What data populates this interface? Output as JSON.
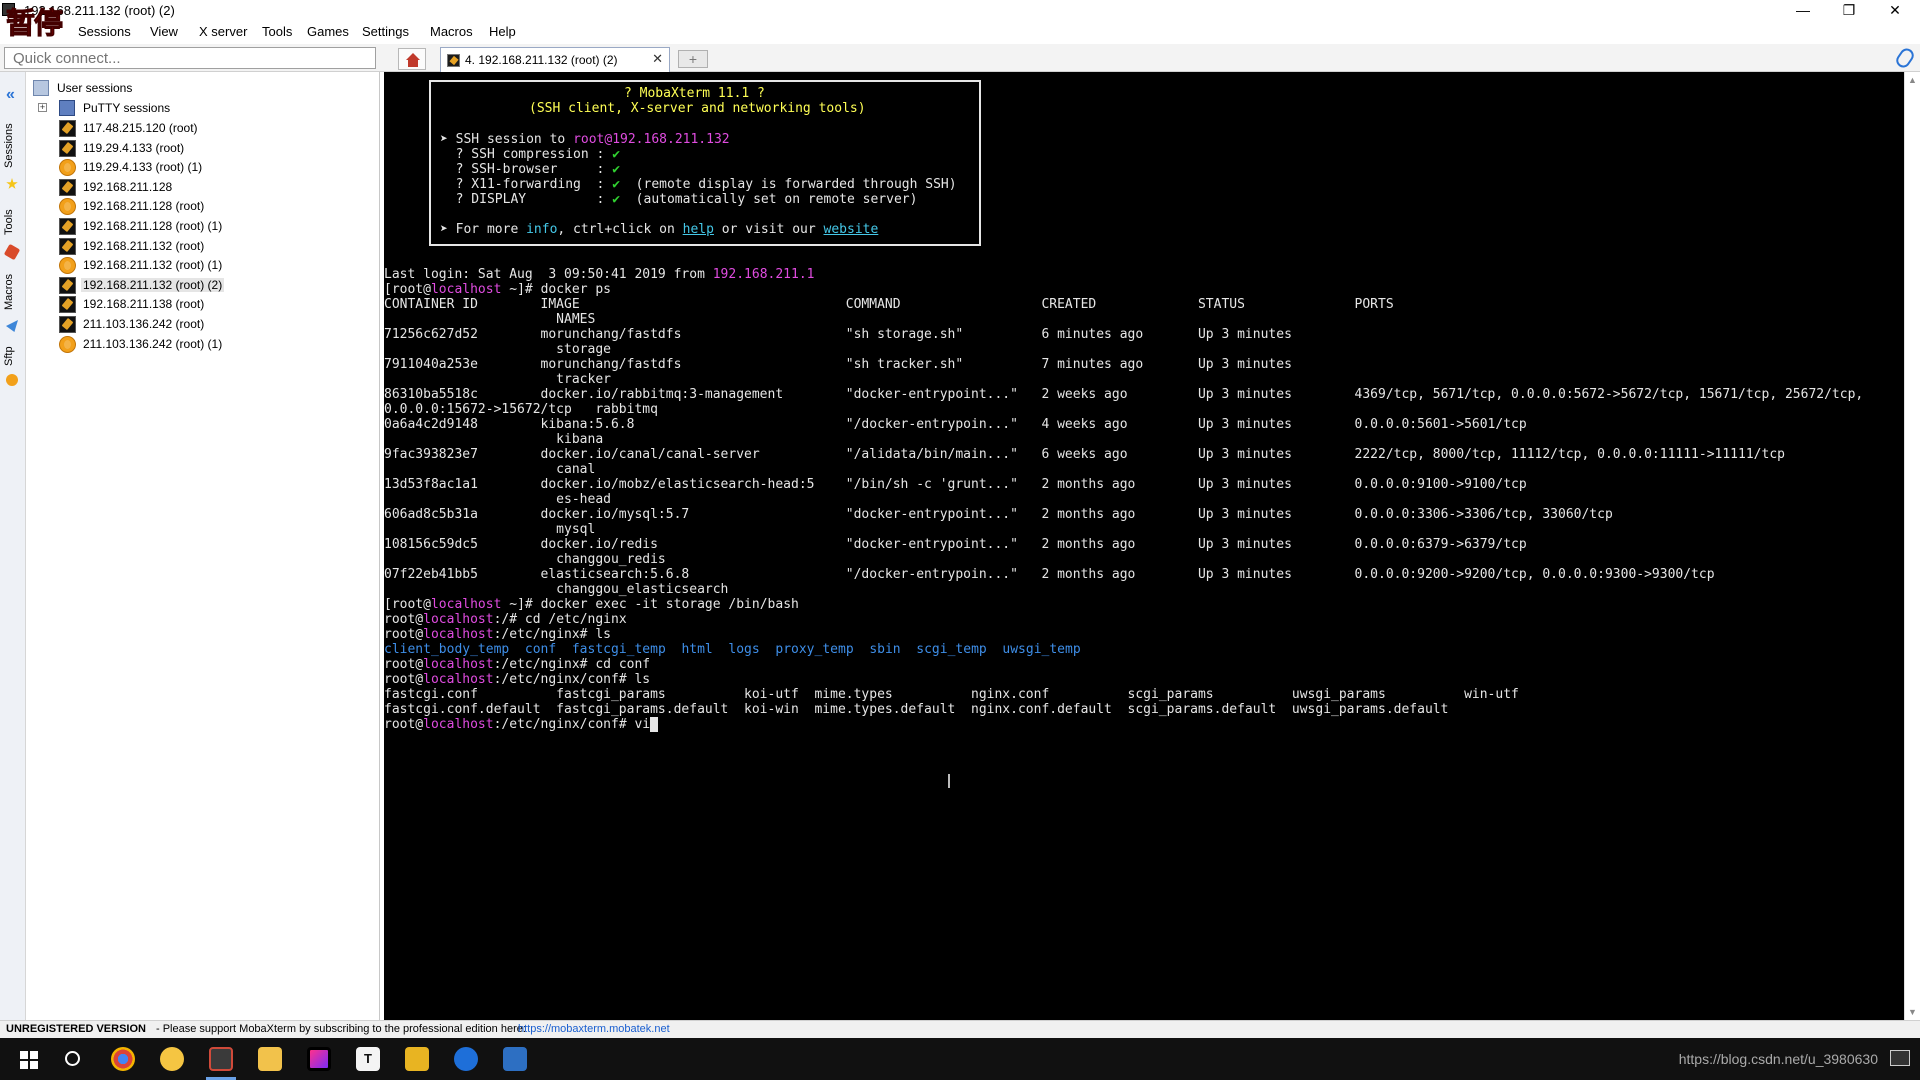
{
  "window": {
    "title": "192.168.211.132 (root) (2)",
    "overlay_badge": "暂停",
    "minimize": "—",
    "maximize": "❐",
    "close": "✕"
  },
  "menu": [
    "Sessions",
    "View",
    "X server",
    "Tools",
    "Games",
    "Settings",
    "Macros",
    "Help"
  ],
  "quick_connect": {
    "placeholder": "Quick connect..."
  },
  "tabs": {
    "active_label": "4. 192.168.211.132 (root) (2)",
    "close_glyph": "✕",
    "new_tab_glyph": "+"
  },
  "side_tabs": [
    "Sessions",
    "Tools",
    "Macros",
    "Sftp"
  ],
  "sessions": {
    "root_label": "User sessions",
    "putty_label": "PuTTY sessions",
    "items": [
      {
        "label": "117.48.215.120 (root)",
        "icon": "ssh-icon"
      },
      {
        "label": "119.29.4.133 (root)",
        "icon": "ssh-icon"
      },
      {
        "label": "119.29.4.133 (root) (1)",
        "icon": "globe-icon"
      },
      {
        "label": "192.168.211.128",
        "icon": "ssh-icon"
      },
      {
        "label": "192.168.211.128 (root)",
        "icon": "globe-icon"
      },
      {
        "label": "192.168.211.128 (root) (1)",
        "icon": "ssh-icon"
      },
      {
        "label": "192.168.211.132 (root)",
        "icon": "ssh-icon"
      },
      {
        "label": "192.168.211.132 (root) (1)",
        "icon": "globe-icon"
      },
      {
        "label": "192.168.211.132 (root) (2)",
        "icon": "ssh-icon",
        "selected": true
      },
      {
        "label": "192.168.211.138 (root)",
        "icon": "ssh-icon"
      },
      {
        "label": "211.103.136.242 (root)",
        "icon": "ssh-icon"
      },
      {
        "label": "211.103.136.242 (root) (1)",
        "icon": "globe-icon"
      }
    ]
  },
  "terminal": {
    "banner": {
      "title": "? MobaXterm 11.1 ?",
      "subtitle": "(SSH client, X-server and networking tools)",
      "ssh_prefix": "➤ SSH session to ",
      "ssh_user": "root",
      "ssh_host": "@192.168.211.132",
      "features": [
        {
          "text": "  ? SSH compression : ",
          "mark": "✔",
          "note": ""
        },
        {
          "text": "  ? SSH-browser     : ",
          "mark": "✔",
          "note": ""
        },
        {
          "text": "  ? X11-forwarding  : ",
          "mark": "✔",
          "note": "  (remote display is forwarded through SSH)"
        },
        {
          "text": "  ? DISPLAY         : ",
          "mark": "✔",
          "note": "  (automatically set on remote server)"
        }
      ],
      "more_prefix": "➤ For more ",
      "more_info": "info",
      "more_mid": ", ctrl+click on ",
      "more_help": "help",
      "more_or": " or visit our ",
      "more_website": "website"
    },
    "last_login": {
      "prefix": "Last login: Sat Aug  3 09:50:41 2019 from ",
      "host": "192.168.211.1"
    },
    "prompt_a": {
      "open": "[root@",
      "host": "localhost",
      "rest": " ~]# "
    },
    "cmd_docker_ps": "docker ps",
    "table_header": "CONTAINER ID        IMAGE                                  COMMAND                  CREATED             STATUS              PORTS",
    "table_header_names": "                      NAMES",
    "rows": [
      [
        "71256c627d52        morunchang/fastdfs                     \"sh storage.sh\"          6 minutes ago       Up 3 minutes",
        "                      storage"
      ],
      [
        "7911040a253e        morunchang/fastdfs                     \"sh tracker.sh\"          7 minutes ago       Up 3 minutes",
        "                      tracker"
      ],
      [
        "86310ba5518c        docker.io/rabbitmq:3-management        \"docker-entrypoint...\"   2 weeks ago         Up 3 minutes        4369/tcp, 5671/tcp, 0.0.0.0:5672->5672/tcp, 15671/tcp, 25672/tcp,",
        "0.0.0.0:15672->15672/tcp   rabbitmq"
      ],
      [
        "0a6a4c2d9148        kibana:5.6.8                           \"/docker-entrypoin...\"   4 weeks ago         Up 3 minutes        0.0.0.0:5601->5601/tcp",
        "                      kibana"
      ],
      [
        "9fac393823e7        docker.io/canal/canal-server           \"/alidata/bin/main...\"   6 weeks ago         Up 3 minutes        2222/tcp, 8000/tcp, 11112/tcp, 0.0.0.0:11111->11111/tcp",
        "                      canal"
      ],
      [
        "13d53f8ac1a1        docker.io/mobz/elasticsearch-head:5    \"/bin/sh -c 'grunt...\"   2 months ago        Up 3 minutes        0.0.0.0:9100->9100/tcp",
        "                      es-head"
      ],
      [
        "606ad8c5b31a        docker.io/mysql:5.7                    \"docker-entrypoint...\"   2 months ago        Up 3 minutes        0.0.0.0:3306->3306/tcp, 33060/tcp",
        "                      mysql"
      ],
      [
        "108156c59dc5        docker.io/redis                        \"docker-entrypoint...\"   2 months ago        Up 3 minutes        0.0.0.0:6379->6379/tcp",
        "                      changgou_redis"
      ],
      [
        "07f22eb41bb5        elasticsearch:5.6.8                    \"/docker-entrypoin...\"   2 months ago        Up 3 minutes        0.0.0.0:9200->9200/tcp, 0.0.0.0:9300->9300/tcp",
        "                      changgou_elasticsearch"
      ]
    ],
    "cmd_exec": "docker exec -it storage /bin/bash",
    "root_prompt": {
      "user": "root@",
      "host": "localhost"
    },
    "line_cd_nginx": {
      "path": ":/# ",
      "cmd": "cd /etc/nginx"
    },
    "line_ls1": {
      "path": ":/etc/nginx# ",
      "cmd": "ls"
    },
    "ls_nginx": [
      {
        "name": "client_body_temp",
        "gap": "  "
      },
      {
        "name": "conf",
        "gap": "  "
      },
      {
        "name": "fastcgi_temp",
        "gap": "  "
      },
      {
        "name": "html",
        "gap": "  "
      },
      {
        "name": "logs",
        "gap": "  "
      },
      {
        "name": "proxy_temp",
        "gap": "  "
      },
      {
        "name": "sbin",
        "gap": "  "
      },
      {
        "name": "scgi_temp",
        "gap": "  "
      },
      {
        "name": "uwsgi_temp",
        "gap": ""
      }
    ],
    "line_cd_conf": {
      "path": ":/etc/nginx# ",
      "cmd": "cd conf"
    },
    "line_ls2": {
      "path": ":/etc/nginx/conf# ",
      "cmd": "ls"
    },
    "ls_conf_1": "fastcgi.conf          fastcgi_params          koi-utf  mime.types          nginx.conf          scgi_params          uwsgi_params          win-utf",
    "ls_conf_2": "fastcgi.conf.default  fastcgi_params.default  koi-win  mime.types.default  nginx.conf.default  scgi_params.default  uwsgi_params.default",
    "line_vi": {
      "path": ":/etc/nginx/conf# ",
      "cmd": "vi"
    }
  },
  "status": {
    "bold": "UNREGISTERED VERSION",
    "message": " -  Please support MobaXterm by subscribing to the professional edition here: ",
    "link": "https://mobaxterm.mobatek.net"
  },
  "taskbar": {
    "tray_text": "https://blog.csdn.net/u_3980630",
    "apps": [
      "chrome",
      "paw",
      "mobaxterm",
      "explorer",
      "jetbrains",
      "typora",
      "app-yellow",
      "app-blue",
      "app-xterm"
    ]
  },
  "colors": {
    "terminal_bg": "#000000",
    "text": "#e6e6e6",
    "yellow": "#ffff55",
    "magenta": "#e04ce0",
    "cyan": "#45c8e8",
    "blue": "#3e8ee8",
    "accent": "#2a74d6"
  }
}
